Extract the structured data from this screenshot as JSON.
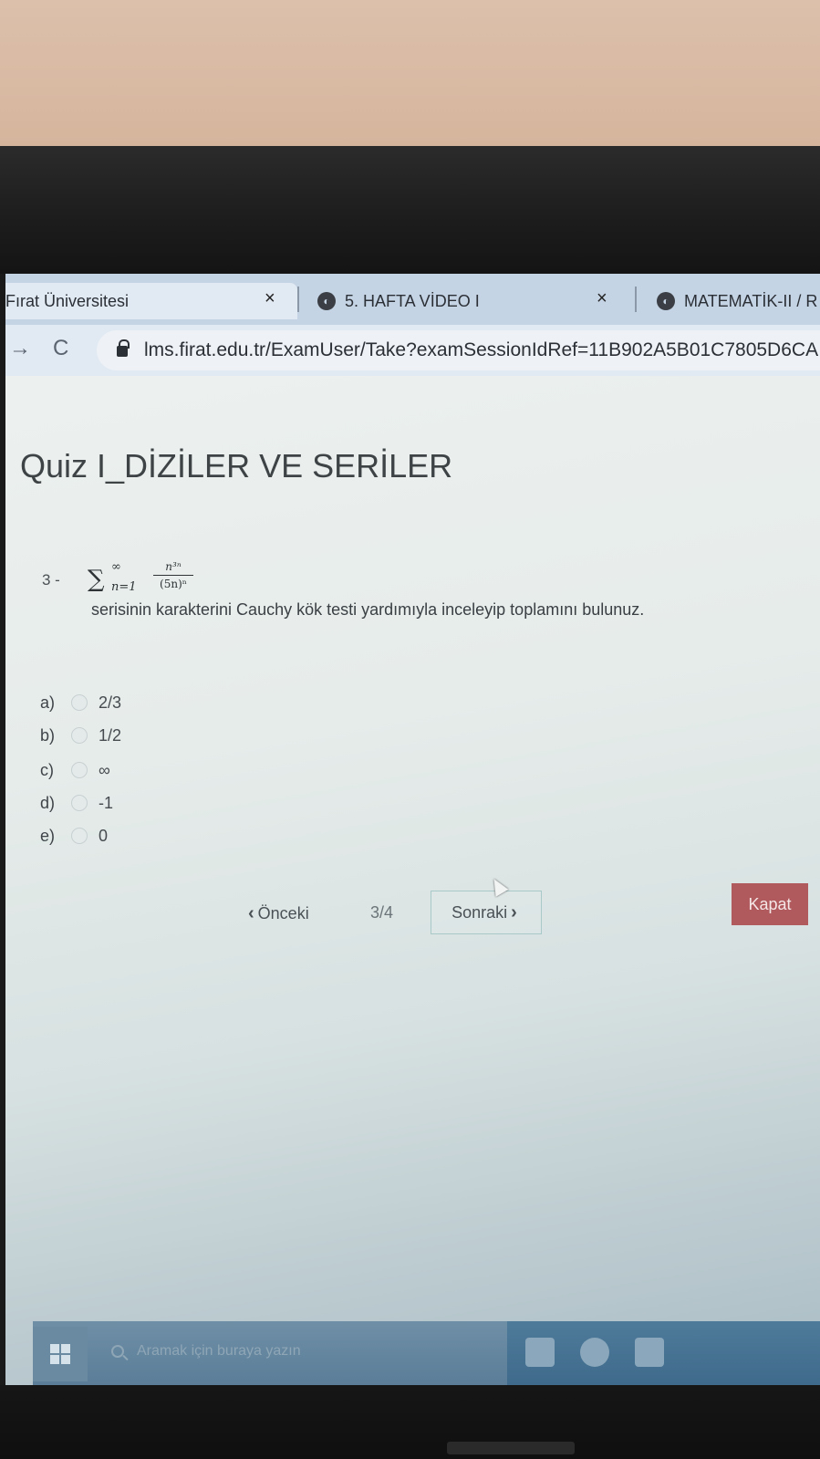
{
  "browser": {
    "tabs": [
      {
        "label": "Fırat Üniversitesi",
        "close": "×"
      },
      {
        "label": "5. HAFTA VİDEO I",
        "close": "×"
      },
      {
        "label": "MATEMATİK-II / R"
      }
    ],
    "url": "lms.firat.edu.tr/ExamUser/Take?examSessionIdRef=11B902A5B01C7805D6CA",
    "forward_icon": "→",
    "reload_icon": "C"
  },
  "quiz": {
    "title": "Quiz I_DİZİLER VE SERİLER",
    "question": {
      "number": "3 -",
      "formula": {
        "sigma": "∑",
        "upper": "∞",
        "lower": "n=1",
        "numerator": "n³ⁿ",
        "denominator": "(5n)ⁿ"
      },
      "text": "serisinin karakterini Cauchy kök testi yardımıyla inceleyip toplamını bulunuz."
    },
    "options": [
      {
        "letter": "a)",
        "value": "2/3"
      },
      {
        "letter": "b)",
        "value": "1/2"
      },
      {
        "letter": "c)",
        "value": "∞"
      },
      {
        "letter": "d)",
        "value": "-1"
      },
      {
        "letter": "e)",
        "value": "0"
      }
    ],
    "nav": {
      "prev_label": "Önceki",
      "counter": "3/4",
      "next_label": "Sonraki",
      "close_label": "Kapat"
    }
  },
  "taskbar": {
    "search_placeholder": "Aramak için buraya yazın"
  },
  "colors": {
    "close_button": "#b05a5e",
    "tab_bar": "#c5d4e4",
    "taskbar": "#5b7d97"
  }
}
